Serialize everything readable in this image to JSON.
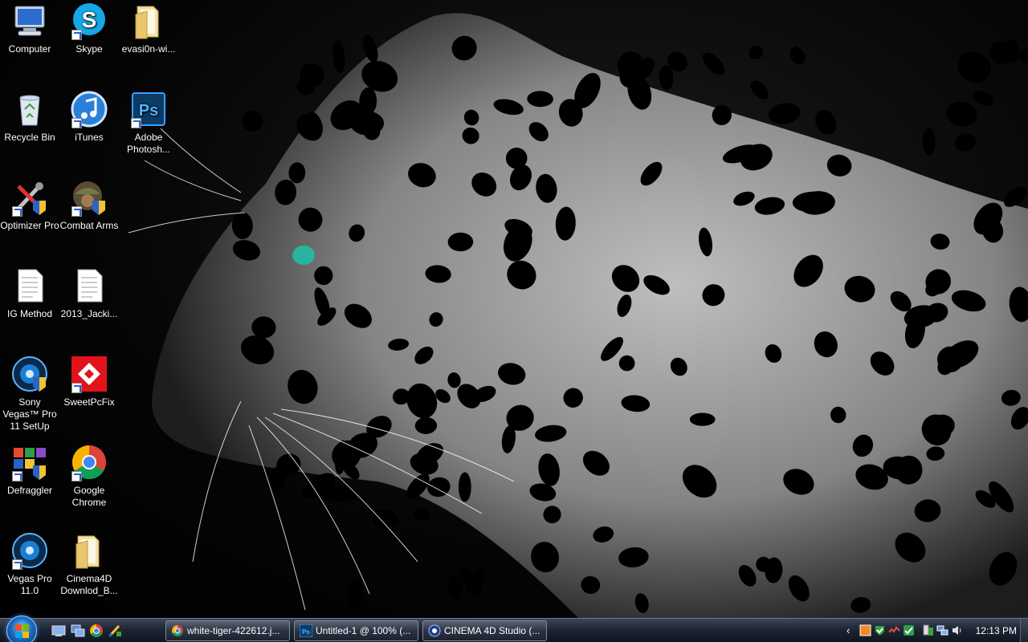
{
  "desktop": {
    "icons": [
      {
        "label": "Computer",
        "icon": "computer-icon"
      },
      {
        "label": "Skype",
        "icon": "skype-icon"
      },
      {
        "label": "evasi0n-wi...",
        "icon": "folder-icon"
      },
      {
        "label": "Recycle Bin",
        "icon": "recycle-bin-icon"
      },
      {
        "label": "iTunes",
        "icon": "itunes-icon"
      },
      {
        "label": "Adobe Photosh...",
        "icon": "photoshop-icon"
      },
      {
        "label": "Optimizer Pro",
        "icon": "optimizer-icon"
      },
      {
        "label": "Combat Arms",
        "icon": "combat-arms-icon"
      },
      {
        "label": "IG Method",
        "icon": "text-file-icon"
      },
      {
        "label": "2013_Jacki...",
        "icon": "text-file-icon"
      },
      {
        "label": "Sony Vegas™ Pro 11 SetUp",
        "icon": "vegas-icon"
      },
      {
        "label": "SweetPcFix",
        "icon": "sweetpcfix-icon"
      },
      {
        "label": "Defraggler",
        "icon": "defraggler-icon"
      },
      {
        "label": "Google Chrome",
        "icon": "chrome-icon"
      },
      {
        "label": "Vegas Pro 11.0",
        "icon": "vegas-icon"
      },
      {
        "label": "Cinema4D Downlod_B...",
        "icon": "folder-icon"
      }
    ]
  },
  "taskbar": {
    "buttons": [
      {
        "label": "white-tiger-422612.j...",
        "icon": "chrome-icon"
      },
      {
        "label": "Untitled-1 @ 100% (...",
        "icon": "photoshop-icon"
      },
      {
        "label": "CINEMA 4D Studio (...",
        "icon": "cinema4d-icon"
      }
    ],
    "clock": "12:13 PM"
  },
  "colors": {
    "taskbar": "#1e2633",
    "start_orb": "#1a6cc4",
    "accent_blue": "#2a63c8"
  }
}
